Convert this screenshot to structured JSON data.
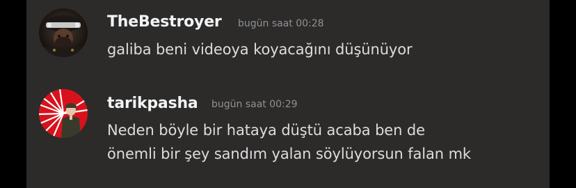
{
  "messages": [
    {
      "username": "TheBestroyer",
      "timestamp": "bugün saat 00:28",
      "lines": [
        "galiba beni videoya koyacağını düşünüyor"
      ],
      "avatar_icon": "masked-rider-avatar"
    },
    {
      "username": "tarikpasha",
      "timestamp": "bugün saat 00:29",
      "lines": [
        "Neden böyle bir hataya düştü acaba ben de",
        "önemli bir şey sandım yalan söylüyorsun falan mk"
      ],
      "avatar_icon": "red-flag-soldier-avatar"
    }
  ],
  "colors": {
    "background": "#2c2b29",
    "username": "#f2f3f5",
    "text": "#dcdde0",
    "timestamp": "#8e9196",
    "avatar_red": "#d8121c"
  }
}
